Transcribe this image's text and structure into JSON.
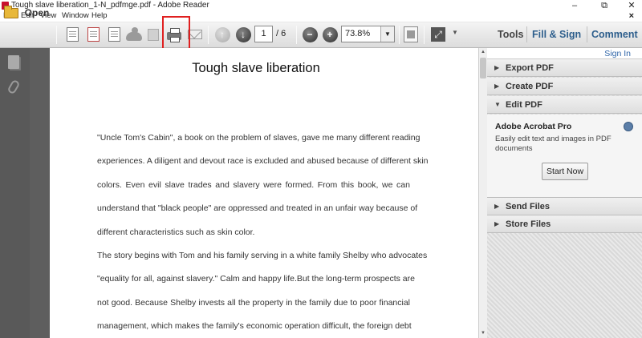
{
  "window": {
    "title": "Tough slave liberation_1-N_pdfmge.pdf - Adobe Reader",
    "minimize": "–",
    "restore": "⧉",
    "close": "✕"
  },
  "menu": {
    "items": [
      "File",
      "Edit",
      "View",
      "Window",
      "Help"
    ],
    "close": "×"
  },
  "toolbar": {
    "open_label": "Open",
    "page_current": "1",
    "page_total": "/ 6",
    "zoom": "73.8%",
    "prev_page": "↑",
    "next_page": "↓",
    "zoom_out": "−",
    "zoom_in": "+",
    "dropdown_arrow": "▼",
    "tabs": [
      "Tools",
      "Fill & Sign",
      "Comment"
    ]
  },
  "document": {
    "title": "Tough slave liberation",
    "lines": [
      "\"Uncle Tom's Cabin\", a book on the problem of slaves, gave me many different reading",
      "experiences. A diligent and devout race is excluded and abused because of different skin",
      "colors. Even evil slave trades and slavery were formed. From this book, we can",
      "understand that \"black people\" are oppressed and treated in an unfair way because of",
      "different characteristics such as skin color.",
      "The story begins with Tom and his family serving in a white family Shelby who advocates",
      "\"equality for all, against slavery.\" Calm and happy life.But the long-term prospects are",
      "not good. Because Shelby invests all the property in the family due to poor financial",
      "management, which makes the family's economic operation difficult, the foreign debt"
    ]
  },
  "panel": {
    "sign_in": "Sign In",
    "sections": {
      "export_pdf": "Export PDF",
      "create_pdf": "Create PDF",
      "edit_pdf": "Edit PDF",
      "send_files": "Send Files",
      "store_files": "Store Files"
    },
    "collapsed_arrow": "▶",
    "expanded_arrow": "▼",
    "acrobat_title": "Adobe Acrobat Pro",
    "acrobat_desc": "Easily edit text and images in PDF documents",
    "start_now": "Start Now"
  },
  "colors": {
    "highlight_box": "#e02020",
    "link_blue": "#2f65a8",
    "nav_panel": "#595959"
  }
}
